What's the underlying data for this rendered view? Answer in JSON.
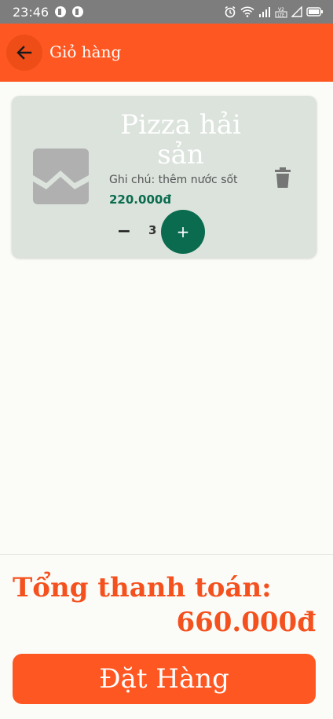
{
  "status_bar": {
    "time": "23:46",
    "icons": [
      "app-notification-icon",
      "app-notification-icon",
      "alarm-icon",
      "wifi-icon",
      "signal-icon",
      "volte-icon",
      "signal-empty-icon",
      "battery-icon"
    ]
  },
  "app_bar": {
    "title": "Giỏ hàng",
    "back_icon": "arrow-left-icon",
    "color": "#ff5722"
  },
  "cart": {
    "items": [
      {
        "name": "Pizza hải sản",
        "note": "Ghi chú: thêm nước sốt",
        "price": "220.000đ",
        "quantity": "3",
        "decrement_label": "−",
        "increment_label": "+",
        "image_icon": "broken-image-icon",
        "delete_icon": "trash-icon"
      }
    ]
  },
  "footer": {
    "total_label": "Tổng thanh toán:",
    "total_value": "660.000đ",
    "order_button_label": "Đặt Hàng"
  },
  "colors": {
    "primary": "#ff5722",
    "accent": "#0a6b4f",
    "card": "#dbe3dc",
    "background": "#fbfbf7"
  }
}
